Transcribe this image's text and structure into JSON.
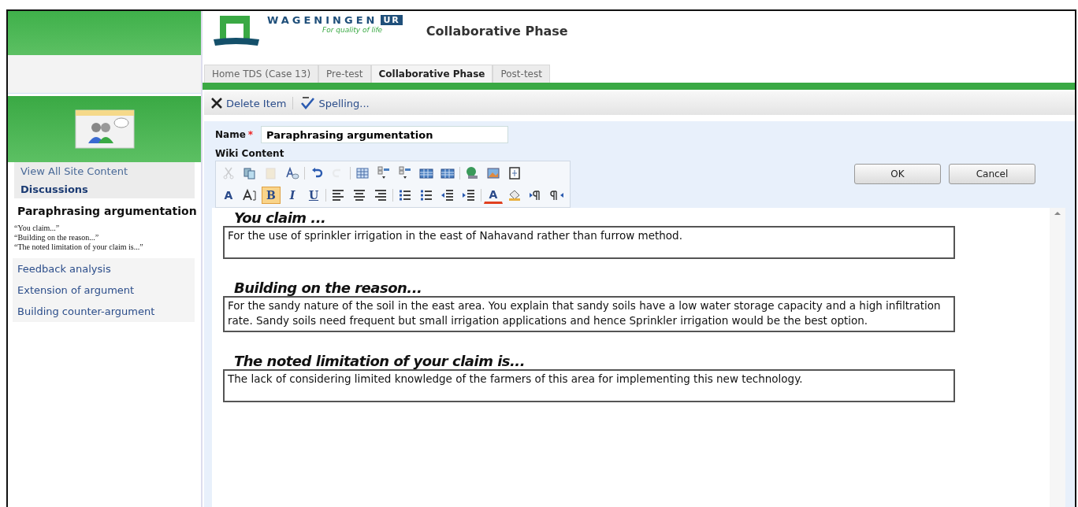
{
  "logo": {
    "name": "WAGENINGEN",
    "badge": "UR",
    "tagline": "For quality of life"
  },
  "site_title": "Collaborative Phase",
  "tabs": [
    {
      "label": "Home TDS (Case 13)",
      "selected": false
    },
    {
      "label": "Pre-test",
      "selected": false
    },
    {
      "label": "Collaborative Phase",
      "selected": true
    },
    {
      "label": "Post-test",
      "selected": false
    }
  ],
  "sidebar": {
    "view_all": "View All Site Content",
    "section": "Discussions",
    "items": [
      {
        "label": "Paraphrasing argumentation",
        "selected": true,
        "notes": [
          "“You claim...”",
          "“Building on the reason...”",
          "“The noted limitation of your claim is...”"
        ]
      },
      {
        "label": "Feedback analysis",
        "selected": false
      },
      {
        "label": "Extension of argument",
        "selected": false
      },
      {
        "label": "Building counter-argument",
        "selected": false
      }
    ]
  },
  "actions": [
    "Delete Item",
    "Spelling..."
  ],
  "form": {
    "name_label": "Name",
    "required_mark": "*",
    "name_value": "Paraphrasing argumentation",
    "content_label": "Wiki Content",
    "toolbar": [
      [
        {
          "disabled": true
        },
        {
          "disabled": false
        },
        {
          "disabled": true
        },
        {
          "disabled": false
        },
        {
          "disabled": false
        },
        {
          "disabled": true
        },
        {
          "disabled": false
        },
        {
          "disabled": false
        },
        {
          "disabled": false
        },
        {
          "disabled": false
        },
        {
          "disabled": false
        },
        {
          "disabled": false
        },
        {
          "disabled": false
        },
        {
          "disabled": false
        }
      ],
      [
        {
          "label": "A",
          "selected": false
        },
        {
          "selected": false
        },
        {
          "label": "B",
          "selected": true
        },
        {
          "label": "I",
          "selected": false
        },
        {
          "label": "U",
          "selected": false
        },
        {
          "selected": false
        },
        {
          "selected": false
        },
        {
          "selected": false
        },
        {
          "selected": false
        },
        {
          "selected": false
        },
        {
          "selected": false
        },
        {
          "selected": false
        },
        {
          "label": "A",
          "selected": false
        },
        {
          "selected": false
        },
        {
          "selected": false
        },
        {
          "selected": false
        }
      ]
    ],
    "buttons": [
      "OK",
      "Cancel"
    ]
  },
  "sections": [
    {
      "heading": "You claim ...",
      "text": "For the use of sprinkler irrigation in the east of Nahavand rather than furrow method."
    },
    {
      "heading": "Building on the reason...",
      "text": "For the sandy nature of the soil in the east area. You explain that sandy soils have a low water storage capacity and a high infiltration rate. Sandy soils need frequent but small irrigation applications and hence Sprinkler irrigation would be the best option."
    },
    {
      "heading": "The noted limitation of your claim is...",
      "text": "The lack of considering limited knowledge of the farmers of this area for implementing this new technology."
    }
  ]
}
